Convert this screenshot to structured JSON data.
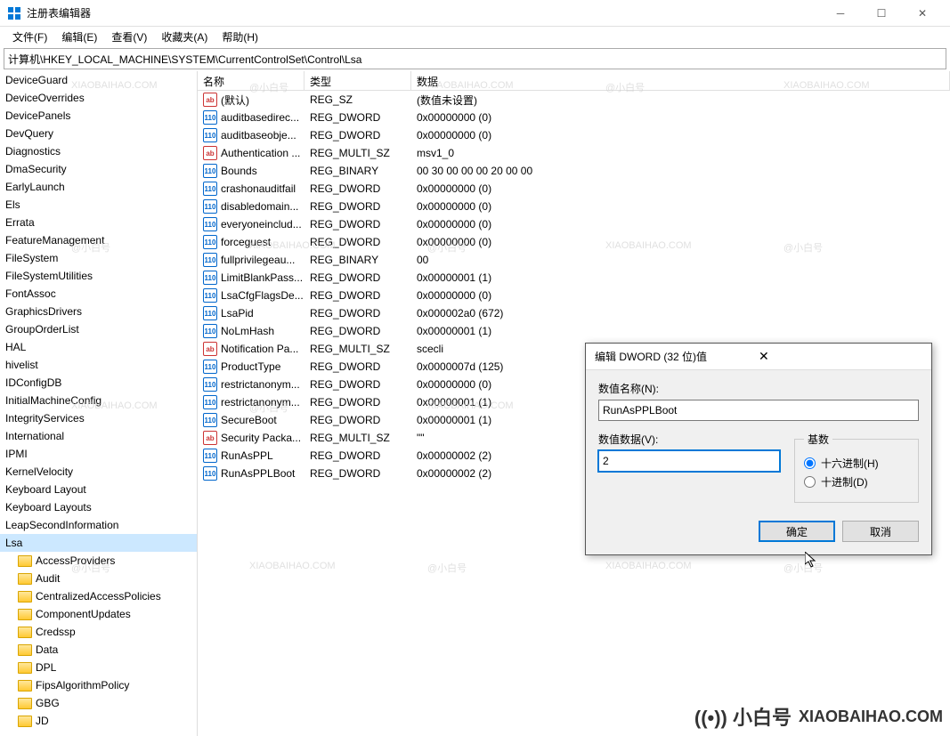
{
  "window": {
    "title": "注册表编辑器"
  },
  "menu": {
    "file": "文件(F)",
    "edit": "编辑(E)",
    "view": "查看(V)",
    "fav": "收藏夹(A)",
    "help": "帮助(H)"
  },
  "address": "计算机\\HKEY_LOCAL_MACHINE\\SYSTEM\\CurrentControlSet\\Control\\Lsa",
  "columns": {
    "name": "名称",
    "type": "类型",
    "data": "数据"
  },
  "tree": [
    {
      "label": "DeviceGuard"
    },
    {
      "label": "DeviceOverrides"
    },
    {
      "label": "DevicePanels"
    },
    {
      "label": "DevQuery"
    },
    {
      "label": "Diagnostics"
    },
    {
      "label": "DmaSecurity"
    },
    {
      "label": "EarlyLaunch"
    },
    {
      "label": "Els"
    },
    {
      "label": "Errata"
    },
    {
      "label": "FeatureManagement"
    },
    {
      "label": "FileSystem"
    },
    {
      "label": "FileSystemUtilities"
    },
    {
      "label": "FontAssoc"
    },
    {
      "label": "GraphicsDrivers"
    },
    {
      "label": "GroupOrderList"
    },
    {
      "label": "HAL"
    },
    {
      "label": "hivelist"
    },
    {
      "label": "IDConfigDB"
    },
    {
      "label": "InitialMachineConfig"
    },
    {
      "label": "IntegrityServices"
    },
    {
      "label": "International"
    },
    {
      "label": "IPMI"
    },
    {
      "label": "KernelVelocity"
    },
    {
      "label": "Keyboard Layout"
    },
    {
      "label": "Keyboard Layouts"
    },
    {
      "label": "LeapSecondInformation"
    },
    {
      "label": "Lsa",
      "sel": true
    },
    {
      "label": "AccessProviders",
      "sub": true
    },
    {
      "label": "Audit",
      "sub": true
    },
    {
      "label": "CentralizedAccessPolicies",
      "sub": true
    },
    {
      "label": "ComponentUpdates",
      "sub": true
    },
    {
      "label": "Credssp",
      "sub": true
    },
    {
      "label": "Data",
      "sub": true
    },
    {
      "label": "DPL",
      "sub": true
    },
    {
      "label": "FipsAlgorithmPolicy",
      "sub": true
    },
    {
      "label": "GBG",
      "sub": true
    },
    {
      "label": "JD",
      "sub": true
    }
  ],
  "values": [
    {
      "name": "(默认)",
      "type": "REG_SZ",
      "data": "(数值未设置)",
      "ic": "sz"
    },
    {
      "name": "auditbasedirec...",
      "type": "REG_DWORD",
      "data": "0x00000000 (0)",
      "ic": "dw"
    },
    {
      "name": "auditbaseobje...",
      "type": "REG_DWORD",
      "data": "0x00000000 (0)",
      "ic": "dw"
    },
    {
      "name": "Authentication ...",
      "type": "REG_MULTI_SZ",
      "data": "msv1_0",
      "ic": "sz"
    },
    {
      "name": "Bounds",
      "type": "REG_BINARY",
      "data": "00 30 00 00 00 20 00 00",
      "ic": "dw"
    },
    {
      "name": "crashonauditfail",
      "type": "REG_DWORD",
      "data": "0x00000000 (0)",
      "ic": "dw"
    },
    {
      "name": "disabledomain...",
      "type": "REG_DWORD",
      "data": "0x00000000 (0)",
      "ic": "dw"
    },
    {
      "name": "everyoneinclud...",
      "type": "REG_DWORD",
      "data": "0x00000000 (0)",
      "ic": "dw"
    },
    {
      "name": "forceguest",
      "type": "REG_DWORD",
      "data": "0x00000000 (0)",
      "ic": "dw"
    },
    {
      "name": "fullprivilegeau...",
      "type": "REG_BINARY",
      "data": "00",
      "ic": "dw"
    },
    {
      "name": "LimitBlankPass...",
      "type": "REG_DWORD",
      "data": "0x00000001 (1)",
      "ic": "dw"
    },
    {
      "name": "LsaCfgFlagsDe...",
      "type": "REG_DWORD",
      "data": "0x00000000 (0)",
      "ic": "dw"
    },
    {
      "name": "LsaPid",
      "type": "REG_DWORD",
      "data": "0x000002a0 (672)",
      "ic": "dw"
    },
    {
      "name": "NoLmHash",
      "type": "REG_DWORD",
      "data": "0x00000001 (1)",
      "ic": "dw"
    },
    {
      "name": "Notification Pa...",
      "type": "REG_MULTI_SZ",
      "data": "scecli",
      "ic": "sz"
    },
    {
      "name": "ProductType",
      "type": "REG_DWORD",
      "data": "0x0000007d (125)",
      "ic": "dw"
    },
    {
      "name": "restrictanonym...",
      "type": "REG_DWORD",
      "data": "0x00000000 (0)",
      "ic": "dw"
    },
    {
      "name": "restrictanonym...",
      "type": "REG_DWORD",
      "data": "0x00000001 (1)",
      "ic": "dw"
    },
    {
      "name": "SecureBoot",
      "type": "REG_DWORD",
      "data": "0x00000001 (1)",
      "ic": "dw"
    },
    {
      "name": "Security Packa...",
      "type": "REG_MULTI_SZ",
      "data": "\"\"",
      "ic": "sz"
    },
    {
      "name": "RunAsPPL",
      "type": "REG_DWORD",
      "data": "0x00000002 (2)",
      "ic": "dw"
    },
    {
      "name": "RunAsPPLBoot",
      "type": "REG_DWORD",
      "data": "0x00000002 (2)",
      "ic": "dw"
    }
  ],
  "dialog": {
    "title": "编辑 DWORD (32 位)值",
    "name_lbl": "数值名称(N):",
    "name_val": "RunAsPPLBoot",
    "data_lbl": "数值数据(V):",
    "data_val": "2",
    "base_lbl": "基数",
    "hex": "十六进制(H)",
    "dec": "十进制(D)",
    "ok": "确定",
    "cancel": "取消"
  },
  "watermark": {
    "brand": "@小白号",
    "domain": "XIAOBAIHAO.COM",
    "big": "((•)) 小白号"
  }
}
